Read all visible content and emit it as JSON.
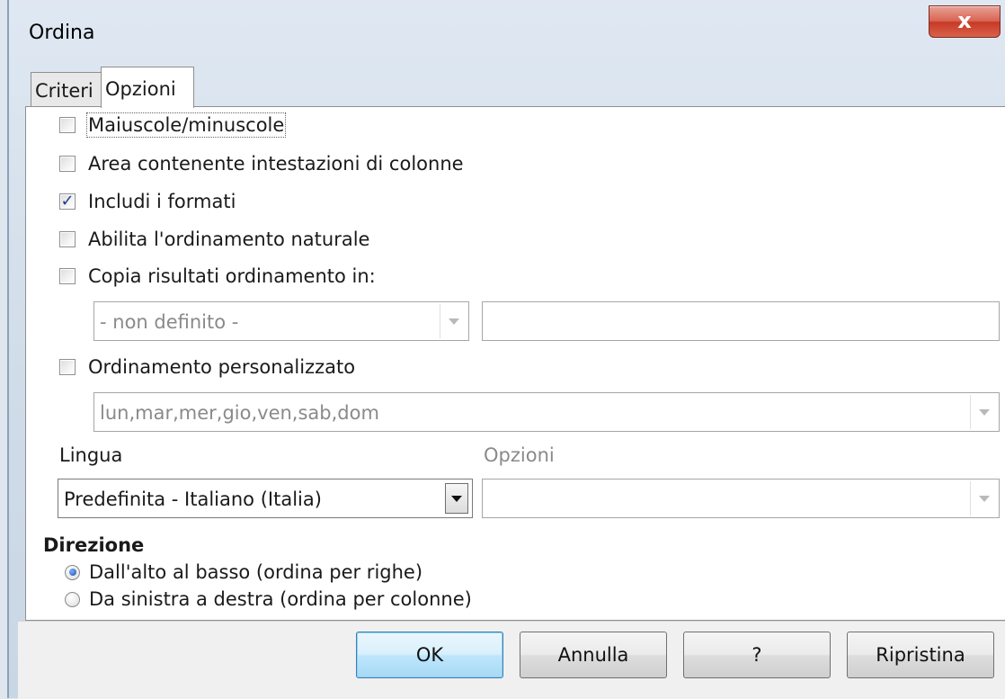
{
  "window": {
    "title": "Ordina",
    "close_label": "x"
  },
  "tabs": [
    {
      "label": "Criteri",
      "active": false
    },
    {
      "label": "Opzioni",
      "active": true
    }
  ],
  "options": {
    "case_sensitive": {
      "label": "Maiuscole/minuscole",
      "checked": false
    },
    "has_headers": {
      "label": "Area contenente intestazioni di colonne",
      "checked": false
    },
    "include_formats": {
      "label": "Includi i formati",
      "checked": true
    },
    "natural_sort": {
      "label": "Abilita l'ordinamento naturale",
      "checked": false
    },
    "copy_results": {
      "label": "Copia risultati ordinamento in:",
      "checked": false
    },
    "copy_target_select": {
      "value": "- non definito -"
    },
    "copy_target_input": {
      "value": ""
    },
    "custom_order": {
      "label": "Ordinamento personalizzato",
      "checked": false
    },
    "custom_order_select": {
      "value": "lun,mar,mer,gio,ven,sab,dom"
    }
  },
  "language": {
    "label": "Lingua",
    "value": "Predefinita - Italiano (Italia)",
    "options_label": "Opzioni",
    "options_value": ""
  },
  "direction": {
    "label": "Direzione",
    "choices": [
      {
        "label": "Dall'alto al basso (ordina per righe)",
        "selected": true
      },
      {
        "label": "Da sinistra a destra (ordina per colonne)",
        "selected": false
      }
    ]
  },
  "buttons": {
    "ok": "OK",
    "cancel": "Annulla",
    "help": "?",
    "reset": "Ripristina"
  },
  "colors": {
    "checkbox_tick": "#1c3f8d",
    "close_button": "#c63a26",
    "default_button": "#bee6fd",
    "disabled_text": "#8a8a8a"
  }
}
